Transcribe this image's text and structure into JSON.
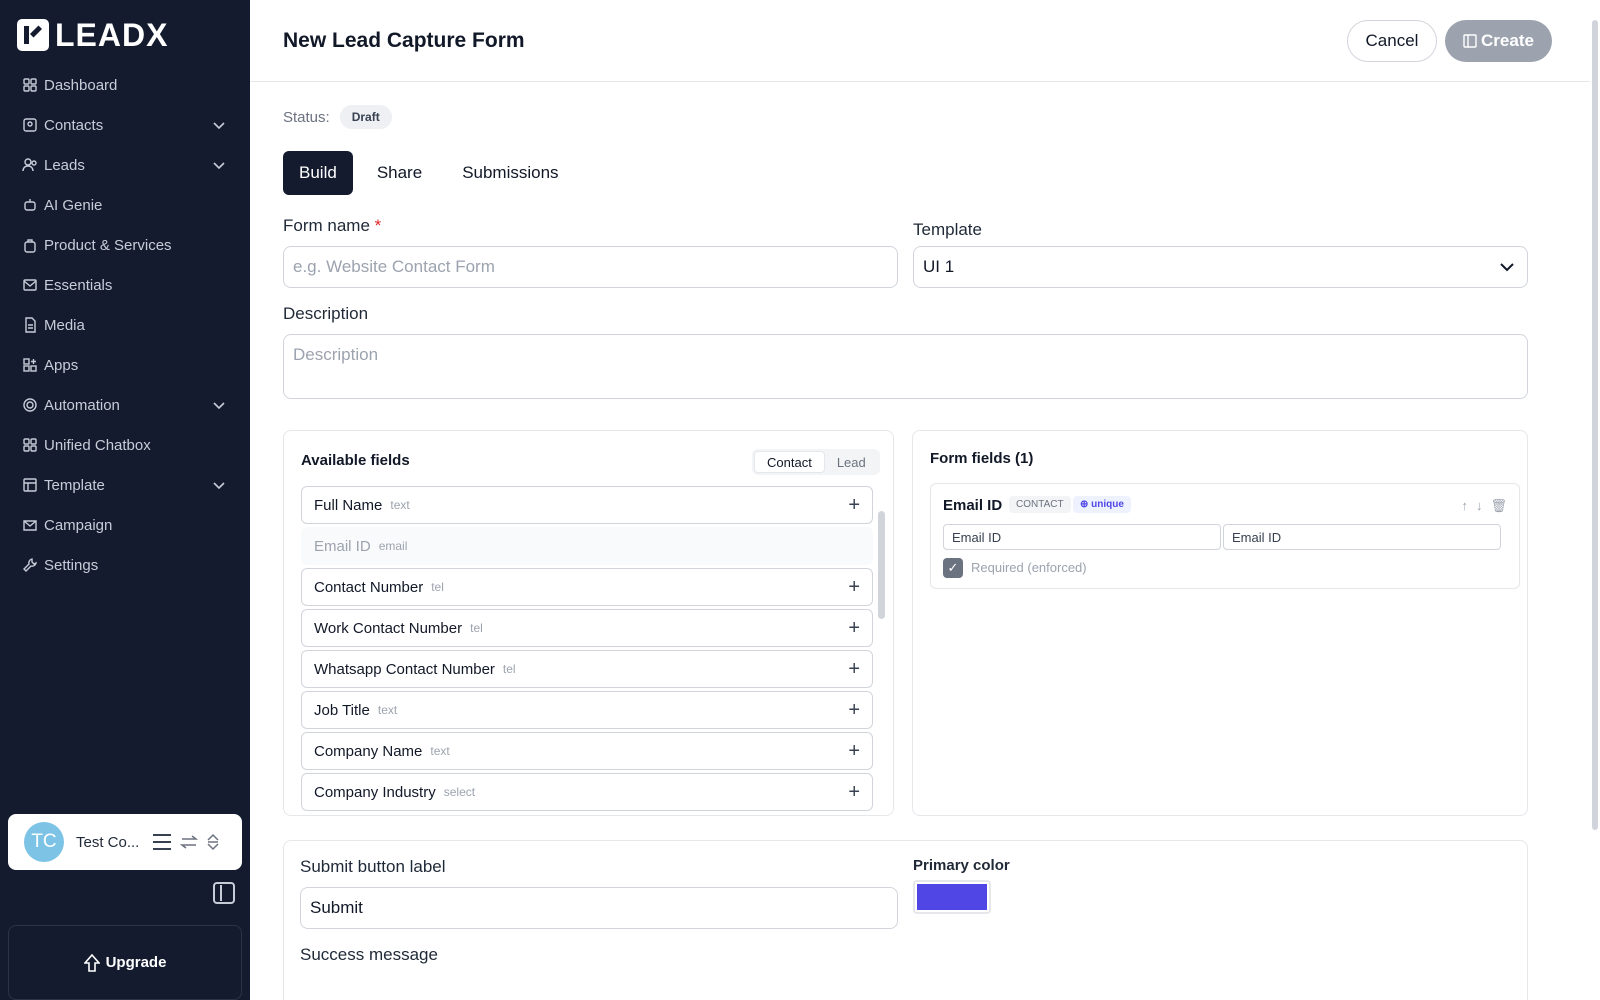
{
  "brand": {
    "name": "LEADX"
  },
  "sidebar": {
    "items": [
      {
        "label": "Dashboard",
        "icon": "grid-icon",
        "expandable": false
      },
      {
        "label": "Contacts",
        "icon": "contact-card-icon",
        "expandable": true
      },
      {
        "label": "Leads",
        "icon": "users-icon",
        "expandable": true
      },
      {
        "label": "AI Genie",
        "icon": "robot-icon",
        "expandable": false
      },
      {
        "label": "Product & Services",
        "icon": "bag-icon",
        "expandable": false
      },
      {
        "label": "Essentials",
        "icon": "mail-icon",
        "expandable": false
      },
      {
        "label": "Media",
        "icon": "file-icon",
        "expandable": false
      },
      {
        "label": "Apps",
        "icon": "apps-icon",
        "expandable": false
      },
      {
        "label": "Automation",
        "icon": "gear-icon",
        "expandable": true
      },
      {
        "label": "Unified Chatbox",
        "icon": "grid-icon",
        "expandable": false
      },
      {
        "label": "Template",
        "icon": "template-icon",
        "expandable": true
      },
      {
        "label": "Campaign",
        "icon": "envelope-icon",
        "expandable": false
      },
      {
        "label": "Settings",
        "icon": "wrench-icon",
        "expandable": false
      }
    ],
    "user": {
      "initials": "TC",
      "name": "Test Co..."
    },
    "upgrade_label": "Upgrade"
  },
  "header": {
    "title": "New Lead Capture Form",
    "cancel_label": "Cancel",
    "create_label": "Create"
  },
  "status": {
    "label": "Status:",
    "value": "Draft"
  },
  "tabs": [
    {
      "label": "Build",
      "active": true
    },
    {
      "label": "Share",
      "active": false
    },
    {
      "label": "Submissions",
      "active": false
    }
  ],
  "form": {
    "name_label": "Form name",
    "name_required": "*",
    "name_placeholder": "e.g. Website Contact Form",
    "template_label": "Template",
    "template_value": "UI 1",
    "description_label": "Description",
    "description_placeholder": "Description"
  },
  "available_fields": {
    "title": "Available fields",
    "toggle": [
      "Contact",
      "Lead"
    ],
    "items": [
      {
        "name": "Full Name",
        "type": "text",
        "disabled": false
      },
      {
        "name": "Email ID",
        "type": "email",
        "disabled": true
      },
      {
        "name": "Contact Number",
        "type": "tel",
        "disabled": false
      },
      {
        "name": "Work Contact Number",
        "type": "tel",
        "disabled": false
      },
      {
        "name": "Whatsapp Contact Number",
        "type": "tel",
        "disabled": false
      },
      {
        "name": "Job Title",
        "type": "text",
        "disabled": false
      },
      {
        "name": "Company Name",
        "type": "text",
        "disabled": false
      },
      {
        "name": "Company Industry",
        "type": "select",
        "disabled": false
      }
    ]
  },
  "form_fields": {
    "title": "Form fields (1)",
    "items": [
      {
        "name": "Email ID",
        "tag": "CONTACT",
        "unique_label": "unique",
        "label_value": "Email ID",
        "placeholder_value": "Email ID",
        "required_label": "Required (enforced)"
      }
    ]
  },
  "settings": {
    "submit_label_title": "Submit button label",
    "submit_label_value": "Submit",
    "primary_color_title": "Primary color",
    "primary_color": "#4f46e5",
    "success_message_title": "Success message"
  }
}
